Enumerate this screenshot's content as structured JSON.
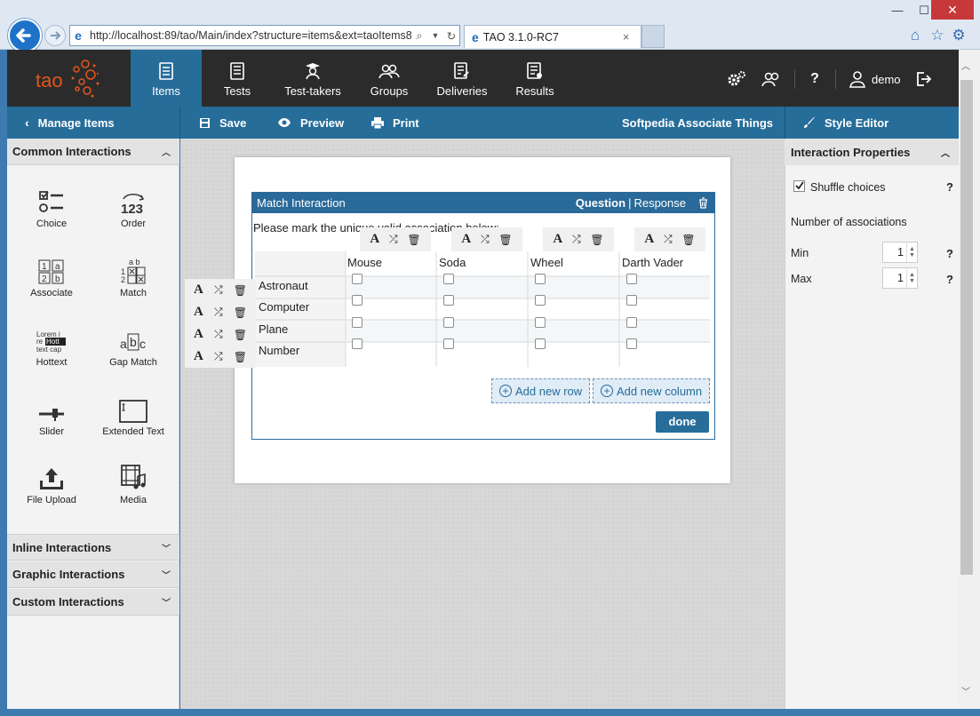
{
  "browser": {
    "url": "http://localhost:89/tao/Main/index?structure=items&ext=taoItems8",
    "tab_title": "TAO 3.1.0-RC7",
    "tab_close": "×",
    "win_min": "—",
    "win_max": "☐",
    "win_close": "✕"
  },
  "header": {
    "logo_text": "tao",
    "nav": [
      {
        "label": "Items",
        "icon": "items-icon",
        "active": true
      },
      {
        "label": "Tests",
        "icon": "tests-icon"
      },
      {
        "label": "Test-takers",
        "icon": "test-takers-icon"
      },
      {
        "label": "Groups",
        "icon": "groups-icon"
      },
      {
        "label": "Deliveries",
        "icon": "deliveries-icon"
      },
      {
        "label": "Results",
        "icon": "results-icon"
      }
    ],
    "help": "?",
    "user": "demo"
  },
  "actionbar": {
    "manage": "Manage Items",
    "save": "Save",
    "preview": "Preview",
    "print": "Print",
    "item_title": "Softpedia Associate Things",
    "style_editor": "Style Editor"
  },
  "left_panel": {
    "sections": {
      "common": "Common Interactions",
      "inline": "Inline Interactions",
      "graphic": "Graphic Interactions",
      "custom": "Custom Interactions"
    },
    "tools": [
      {
        "label": "Choice",
        "icon": "choice-icon"
      },
      {
        "label": "Order",
        "icon": "order-icon"
      },
      {
        "label": "Associate",
        "icon": "associate-icon"
      },
      {
        "label": "Match",
        "icon": "match-icon"
      },
      {
        "label": "Hottext",
        "icon": "hottext-icon"
      },
      {
        "label": "Gap Match",
        "icon": "gap-match-icon"
      },
      {
        "label": "Slider",
        "icon": "slider-icon"
      },
      {
        "label": "Extended Text",
        "icon": "extended-text-icon"
      },
      {
        "label": "File Upload",
        "icon": "file-upload-icon"
      },
      {
        "label": "Media",
        "icon": "media-icon"
      }
    ]
  },
  "interaction": {
    "title": "Match Interaction",
    "question": "Question",
    "separator": "|",
    "response": "Response",
    "prompt": "Please mark the unique valid association below:",
    "columns": [
      "Mouse",
      "Soda",
      "Wheel",
      "Darth Vader"
    ],
    "rows": [
      "Astronaut",
      "Computer",
      "Plane",
      "Number"
    ],
    "add_row": "Add new row",
    "add_column": "Add new column",
    "done": "done"
  },
  "right_panel": {
    "title": "Interaction Properties",
    "shuffle": "Shuffle choices",
    "assoc_title": "Number of associations",
    "min_label": "Min",
    "min_value": "1",
    "max_label": "Max",
    "max_value": "1",
    "help": "?"
  },
  "colors": {
    "brand_blue": "#266d9a",
    "header_dark": "#2b2b2b",
    "accent_orange": "#e1561c"
  }
}
